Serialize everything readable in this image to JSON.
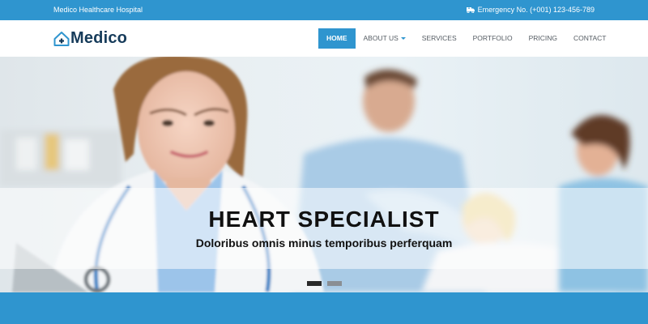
{
  "topbar": {
    "hospital_name": "Medico Healthcare Hospital",
    "emergency_text": "Emergency No. (+001) 123-456-789",
    "emergency_icon": "ambulance-icon"
  },
  "brand": {
    "name": "Medico",
    "logo_icon": "house-cross-icon",
    "color": "#163b5a"
  },
  "nav": {
    "items": [
      {
        "label": "HOME",
        "active": true
      },
      {
        "label": "ABOUT US",
        "dropdown": true
      },
      {
        "label": "SERVICES"
      },
      {
        "label": "PORTFOLIO"
      },
      {
        "label": "PRICING"
      },
      {
        "label": "CONTACT"
      }
    ]
  },
  "hero": {
    "title": "HEART SPECIALIST",
    "subtitle": "Doloribus omnis minus temporibus perferquam",
    "slides_total": 2,
    "slide_active": 1
  },
  "colors": {
    "accent": "#2f95cf",
    "text_dark": "#111111"
  }
}
